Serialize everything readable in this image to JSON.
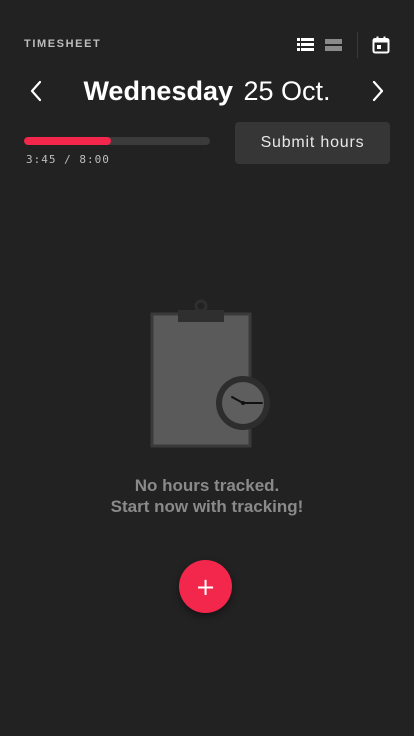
{
  "header": {
    "app_title": "TIMESHEET",
    "icons": [
      "list-view-icon",
      "compact-view-icon",
      "calendar-icon"
    ]
  },
  "date_nav": {
    "day_name": "Wednesday",
    "date": "25 Oct.",
    "prev_icon": "chevron-left-icon",
    "next_icon": "chevron-right-icon"
  },
  "progress": {
    "text": "3:45 / 8:00",
    "fraction": 0.47,
    "fill_color": "#f2274b",
    "track_color": "#3b3b3c"
  },
  "submit": {
    "label": "Submit hours"
  },
  "empty_state": {
    "illustration_icon": "clipboard-clock-icon",
    "line1": "No hours tracked.",
    "line2": "Start now with tracking!"
  },
  "fab": {
    "label": "+",
    "color": "#f2274b"
  },
  "colors": {
    "background": "#222223",
    "accent": "#f2274b",
    "button_bg": "#363637"
  }
}
